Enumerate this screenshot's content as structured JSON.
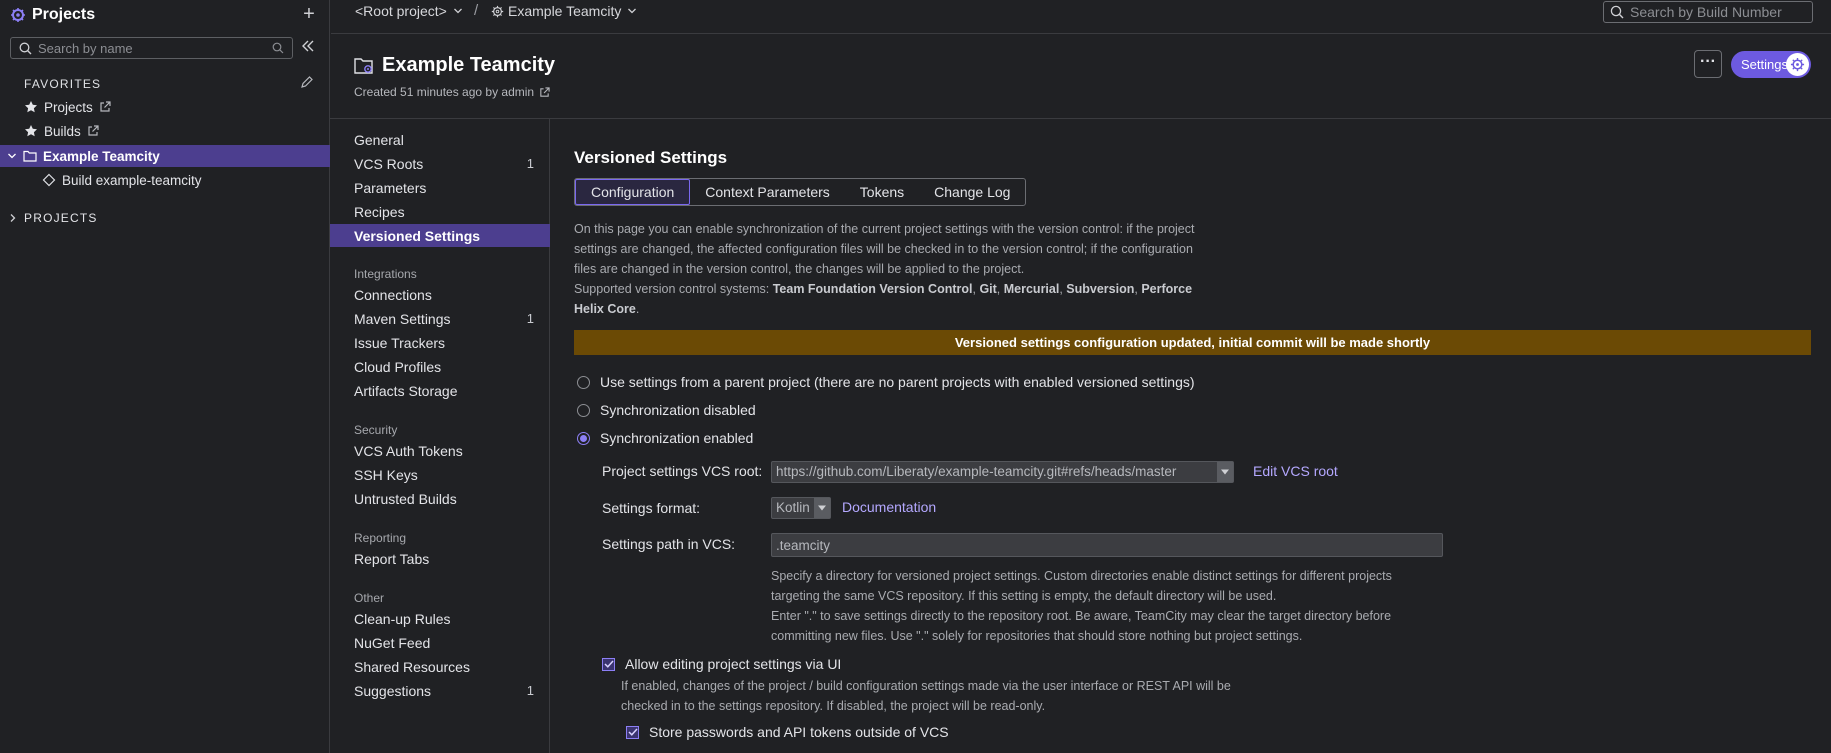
{
  "sidebar": {
    "title": "Projects",
    "search_placeholder": "Search by name",
    "favorites_label": "FAVORITES",
    "favorites": [
      {
        "label": "Projects"
      },
      {
        "label": "Builds"
      }
    ],
    "tree": {
      "project": "Example Teamcity",
      "build": "Build example-teamcity"
    },
    "projects_label": "PROJECTS"
  },
  "topbar": {
    "root_crumb": "<Root project>",
    "project_crumb": "Example Teamcity",
    "search_placeholder": "Search by Build Number"
  },
  "project": {
    "title": "Example Teamcity",
    "meta": "Created 51 minutes ago by admin",
    "settings_label": "Settings",
    "more_label": "···"
  },
  "nav": {
    "items_main": [
      {
        "label": "General",
        "count": ""
      },
      {
        "label": "VCS Roots",
        "count": "1"
      },
      {
        "label": "Parameters",
        "count": ""
      },
      {
        "label": "Recipes",
        "count": ""
      },
      {
        "label": "Versioned Settings",
        "count": ""
      }
    ],
    "integrations_label": "Integrations",
    "items_integrations": [
      {
        "label": "Connections",
        "count": ""
      },
      {
        "label": "Maven Settings",
        "count": "1"
      },
      {
        "label": "Issue Trackers",
        "count": ""
      },
      {
        "label": "Cloud Profiles",
        "count": ""
      },
      {
        "label": "Artifacts Storage",
        "count": ""
      }
    ],
    "security_label": "Security",
    "items_security": [
      {
        "label": "VCS Auth Tokens"
      },
      {
        "label": "SSH Keys"
      },
      {
        "label": "Untrusted Builds"
      }
    ],
    "reporting_label": "Reporting",
    "items_reporting": [
      {
        "label": "Report Tabs"
      }
    ],
    "other_label": "Other",
    "items_other": [
      {
        "label": "Clean-up Rules",
        "count": ""
      },
      {
        "label": "NuGet Feed",
        "count": ""
      },
      {
        "label": "Shared Resources",
        "count": ""
      },
      {
        "label": "Suggestions",
        "count": "1"
      }
    ]
  },
  "main": {
    "title": "Versioned Settings",
    "tabs": [
      {
        "label": "Configuration"
      },
      {
        "label": "Context Parameters"
      },
      {
        "label": "Tokens"
      },
      {
        "label": "Change Log"
      }
    ],
    "description": {
      "line1": "On this page you can enable synchronization of the current project settings with the version control: if the project",
      "line2": "settings are changed, the affected configuration files will be checked in to the version control; if the configuration",
      "line3": "files are changed in the version control, the changes will be applied to the project.",
      "supported_prefix": "Supported version control systems: ",
      "vcs": [
        "Team Foundation Version Control",
        "Git",
        "Mercurial",
        "Subversion",
        "Perforce",
        "Helix Core"
      ],
      "sep": ", "
    },
    "banner": "Versioned settings configuration updated, initial commit will be made shortly",
    "radios": [
      {
        "label": "Use settings from a parent project (there are no parent projects with enabled versioned settings)",
        "checked": false
      },
      {
        "label": "Synchronization disabled",
        "checked": false
      },
      {
        "label": "Synchronization enabled",
        "checked": true
      }
    ],
    "vcs_root_label": "Project settings VCS root:",
    "vcs_root_value": "https://github.com/Liberaty/example-teamcity.git#refs/heads/master",
    "edit_vcs_root": "Edit VCS root",
    "format_label": "Settings format:",
    "format_value": "Kotlin",
    "documentation": "Documentation",
    "path_label": "Settings path in VCS:",
    "path_value": ".teamcity",
    "path_help": [
      "Specify a directory for versioned project settings. Custom directories enable distinct settings for different projects",
      "targeting the same VCS repository. If this setting is empty, the default directory will be used.",
      "Enter \".\" to save settings directly to the repository root. Be aware, TeamCity may clear the target directory before",
      "committing new files. Use \".\" solely for repositories that should store nothing but project settings."
    ],
    "allow_editing_label": "Allow editing project settings via UI",
    "allow_editing_help": [
      "If enabled, changes of the project / build configuration settings made via the user interface or REST API will be",
      "checked in to the settings repository. If disabled, the project will be read-only."
    ],
    "store_passwords_label": "Store passwords and API tokens outside of VCS"
  }
}
